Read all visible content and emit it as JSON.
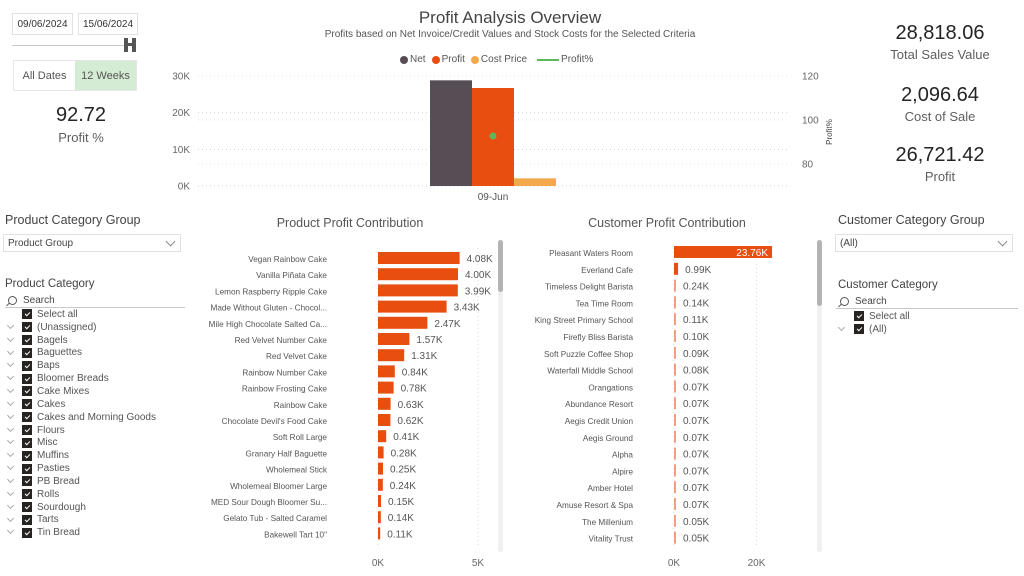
{
  "date_filter": {
    "start_date": "09/06/2024",
    "end_date": "15/06/2024",
    "buttons": [
      {
        "label": "All Dates",
        "selected": false
      },
      {
        "label": "12 Weeks",
        "selected": true
      }
    ]
  },
  "profit_pct_card": {
    "value": "92.72",
    "label": "Profit %"
  },
  "header": {
    "title": "Profit Analysis Overview",
    "subtitle": "Profits based on Net Invoice/Credit Values and Stock Costs for the Selected Criteria"
  },
  "kpis": [
    {
      "value": "28,818.06",
      "label": "Total Sales Value"
    },
    {
      "value": "2,096.64",
      "label": "Cost of Sale"
    },
    {
      "value": "26,721.42",
      "label": "Profit"
    }
  ],
  "colors": {
    "net": "#574d55",
    "profit": "#e84e10",
    "cost_price": "#f2a94e",
    "profit_pct": "#5cb85c",
    "selected_button": "#d4ecd4"
  },
  "chart_data": [
    {
      "type": "bar",
      "title": "Profit Analysis Overview",
      "legend": [
        "Net",
        "Profit",
        "Cost Price",
        "Profit%"
      ],
      "legend_position": "top-center",
      "categories": [
        "09-Jun"
      ],
      "series": [
        {
          "name": "Net",
          "values": [
            28818.06
          ]
        },
        {
          "name": "Profit",
          "values": [
            26721.42
          ]
        },
        {
          "name": "Cost Price",
          "values": [
            2096.64
          ]
        },
        {
          "name": "Profit%",
          "type": "line",
          "axis": "right",
          "values": [
            92.72
          ]
        }
      ],
      "y_ticks": [
        "0K",
        "10K",
        "20K",
        "30K"
      ],
      "ylim": [
        0,
        30000
      ],
      "y2label": "Profit%",
      "y2_ticks": [
        "80",
        "100",
        "120"
      ],
      "y2lim": [
        70,
        120
      ],
      "grid": true
    },
    {
      "type": "bar",
      "orientation": "horizontal",
      "title": "Product Profit Contribution",
      "categories": [
        "Vegan Rainbow Cake",
        "Vanilla Piñata Cake",
        "Lemon Raspberry Ripple Cake",
        "Made Without Gluten - Chocol...",
        "Mile High Chocolate Salted Ca...",
        "Red Velvet Number Cake",
        "Red Velvet Cake",
        "Rainbow Number Cake",
        "Rainbow Frosting Cake",
        "Rainbow Cake",
        "Chocolate Devil's Food Cake",
        "Soft Roll Large",
        "Granary Half Baguette",
        "Wholemeal Stick",
        "Wholemeal Bloomer Large",
        "MED Sour Dough Bloomer Su...",
        "Gelato Tub - Salted Caramel",
        "Bakewell Tart 10\""
      ],
      "values": [
        4080,
        4000,
        3990,
        3430,
        2470,
        1570,
        1310,
        840,
        780,
        630,
        620,
        410,
        280,
        250,
        240,
        150,
        140,
        110
      ],
      "labels": [
        "4.08K",
        "4.00K",
        "3.99K",
        "3.43K",
        "2.47K",
        "1.57K",
        "1.31K",
        "0.84K",
        "0.78K",
        "0.63K",
        "0.62K",
        "0.41K",
        "0.28K",
        "0.25K",
        "0.24K",
        "0.15K",
        "0.14K",
        "0.11K"
      ],
      "x_ticks": [
        "0K",
        "5K"
      ],
      "xlim": [
        0,
        5000
      ],
      "grid": true
    },
    {
      "type": "bar",
      "orientation": "horizontal",
      "title": "Customer Profit Contribution",
      "categories": [
        "Pleasant Waters Room",
        "Everland Cafe",
        "Timeless Delight Barista",
        "Tea Time Room",
        "King Street Primary School",
        "Firefly Bliss Barista",
        "Soft Puzzle Coffee Shop",
        "Waterfall Middle School",
        "Orangations",
        "Abundance Resort",
        "Aegis Credit Union",
        "Aegis Ground",
        "Alpha",
        "Alpire",
        "Amber Hotel",
        "Amuse Resort & Spa",
        "The Millenium",
        "Vitality Trust"
      ],
      "values": [
        23760,
        990,
        240,
        140,
        110,
        100,
        90,
        80,
        70,
        70,
        70,
        70,
        70,
        70,
        70,
        70,
        50,
        50
      ],
      "labels": [
        "23.76K",
        "0.99K",
        "0.24K",
        "0.14K",
        "0.11K",
        "0.10K",
        "0.09K",
        "0.08K",
        "0.07K",
        "0.07K",
        "0.07K",
        "0.07K",
        "0.07K",
        "0.07K",
        "0.07K",
        "0.07K",
        "0.05K",
        "0.05K"
      ],
      "x_ticks": [
        "0K",
        "20K"
      ],
      "xlim": [
        0,
        20000
      ],
      "grid": true
    }
  ],
  "product_slicers": {
    "group_title": "Product Category Group",
    "group_value": "Product Group",
    "category_title": "Product Category",
    "search_placeholder": "Search",
    "select_all": "Select all",
    "items": [
      "(Unassigned)",
      "Bagels",
      "Baguettes",
      "Baps",
      "Bloomer Breads",
      "Cake Mixes",
      "Cakes",
      "Cakes and Morning Goods",
      "Flours",
      "Misc",
      "Muffins",
      "Pasties",
      "PB Bread",
      "Rolls",
      "Sourdough",
      "Tarts",
      "Tin Bread"
    ]
  },
  "customer_slicers": {
    "group_title": "Customer Category Group",
    "group_value": "(All)",
    "category_title": "Customer Category",
    "search_placeholder": "Search",
    "select_all": "Select all",
    "items": [
      "(All)"
    ]
  }
}
